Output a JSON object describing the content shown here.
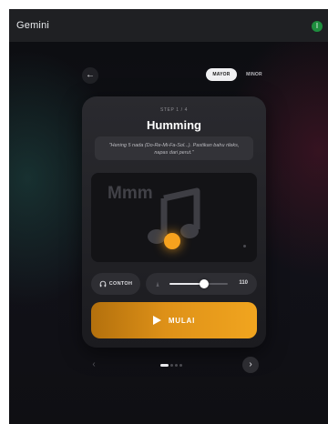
{
  "app": {
    "title": "Gemini",
    "user_initial": "I"
  },
  "nav": {
    "back_icon": "arrow-left-icon",
    "back_glyph": "←"
  },
  "mode": {
    "options": [
      "MAYOR",
      "MINOR"
    ],
    "selected": "MAYOR"
  },
  "exercise": {
    "step_label": "STEP 1 / 4",
    "title": "Humming",
    "instruction": "\"Hening 5 nada (Do-Re-Mi-Fa-Sol...). Pastikan bahu rileks, napas dari perut.\"",
    "visual_text": "Mmm",
    "icon": "music-note-icon"
  },
  "controls": {
    "example_label": "CONTOH",
    "example_icon": "headphones-icon",
    "tempo_icon": "metronome-icon",
    "tempo_value": "110",
    "tempo_fraction": 0.6,
    "start_label": "MULAI",
    "start_icon": "play-icon"
  },
  "pagination": {
    "prev_glyph": "‹",
    "next_glyph": "›",
    "total": 4,
    "current": 1
  },
  "colors": {
    "accent": "#f1a51f",
    "accent_dark": "#b3700d",
    "avatar": "#1e8e3e"
  }
}
